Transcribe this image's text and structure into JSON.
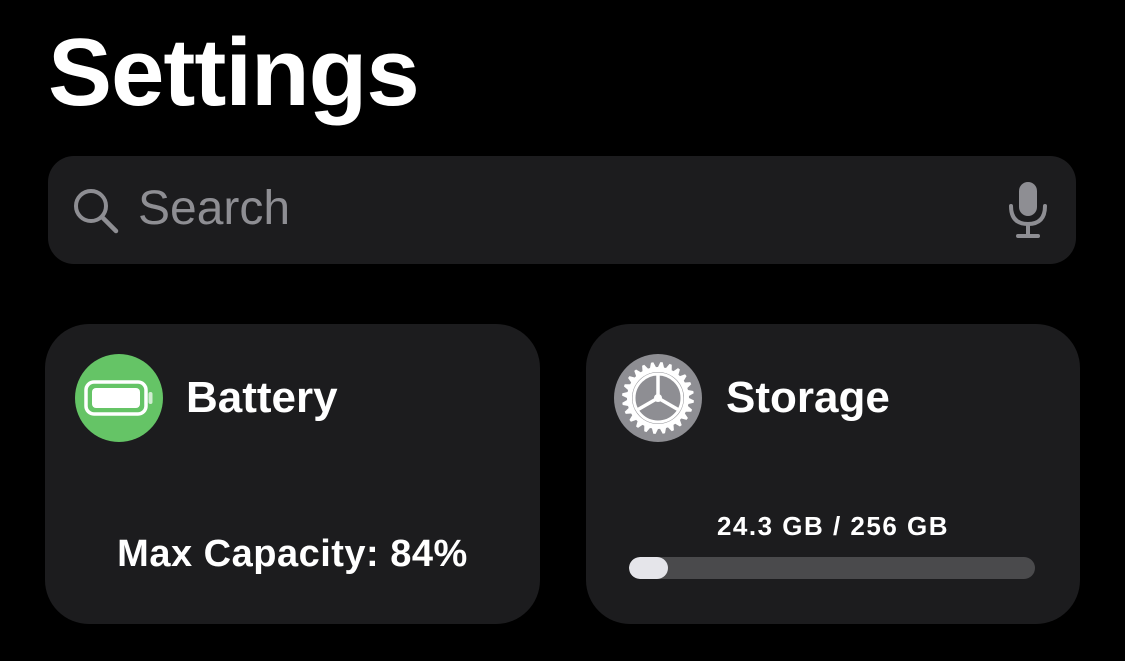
{
  "header": {
    "title": "Settings"
  },
  "search": {
    "placeholder": "Search",
    "value": "",
    "search_icon": "magnifying-glass-icon",
    "mic_icon": "microphone-icon"
  },
  "cards": {
    "battery": {
      "title": "Battery",
      "icon": "battery-icon",
      "icon_color": "#65c466",
      "detail": "Max Capacity: 84%"
    },
    "storage": {
      "title": "Storage",
      "icon": "gear-icon",
      "icon_color": "#8e8e93",
      "usage_text": "24.3 GB / 256 GB",
      "used_gb": 24.3,
      "total_gb": 256
    }
  },
  "colors": {
    "background": "#000000",
    "card": "#1c1c1e",
    "secondary_text": "#8e8e93",
    "bar_track": "#4a4a4c",
    "bar_fill": "#e5e5ea"
  }
}
